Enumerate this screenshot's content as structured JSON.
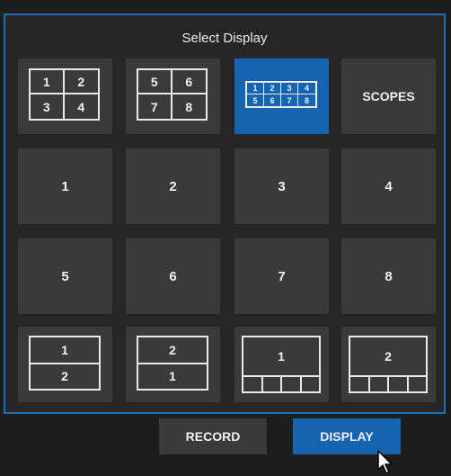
{
  "panel": {
    "title": "Select Display"
  },
  "row1": {
    "quad_a": [
      "1",
      "2",
      "3",
      "4"
    ],
    "quad_b": [
      "5",
      "6",
      "7",
      "8"
    ],
    "octal": [
      "1",
      "2",
      "3",
      "4",
      "5",
      "6",
      "7",
      "8"
    ],
    "scopes_label": "SCOPES"
  },
  "row2": [
    "1",
    "2",
    "3",
    "4"
  ],
  "row3": [
    "5",
    "6",
    "7",
    "8"
  ],
  "row4": {
    "split_a": [
      "1",
      "2"
    ],
    "split_b": [
      "2",
      "1"
    ],
    "strip_a": "1",
    "strip_b": "2"
  },
  "footer": {
    "record_label": "RECORD",
    "display_label": "DISPLAY"
  },
  "colors": {
    "accent": "#1464b0",
    "tile": "#3a3a3a",
    "border": "#1a6fb5"
  },
  "state": {
    "selected_layout": "octal"
  }
}
